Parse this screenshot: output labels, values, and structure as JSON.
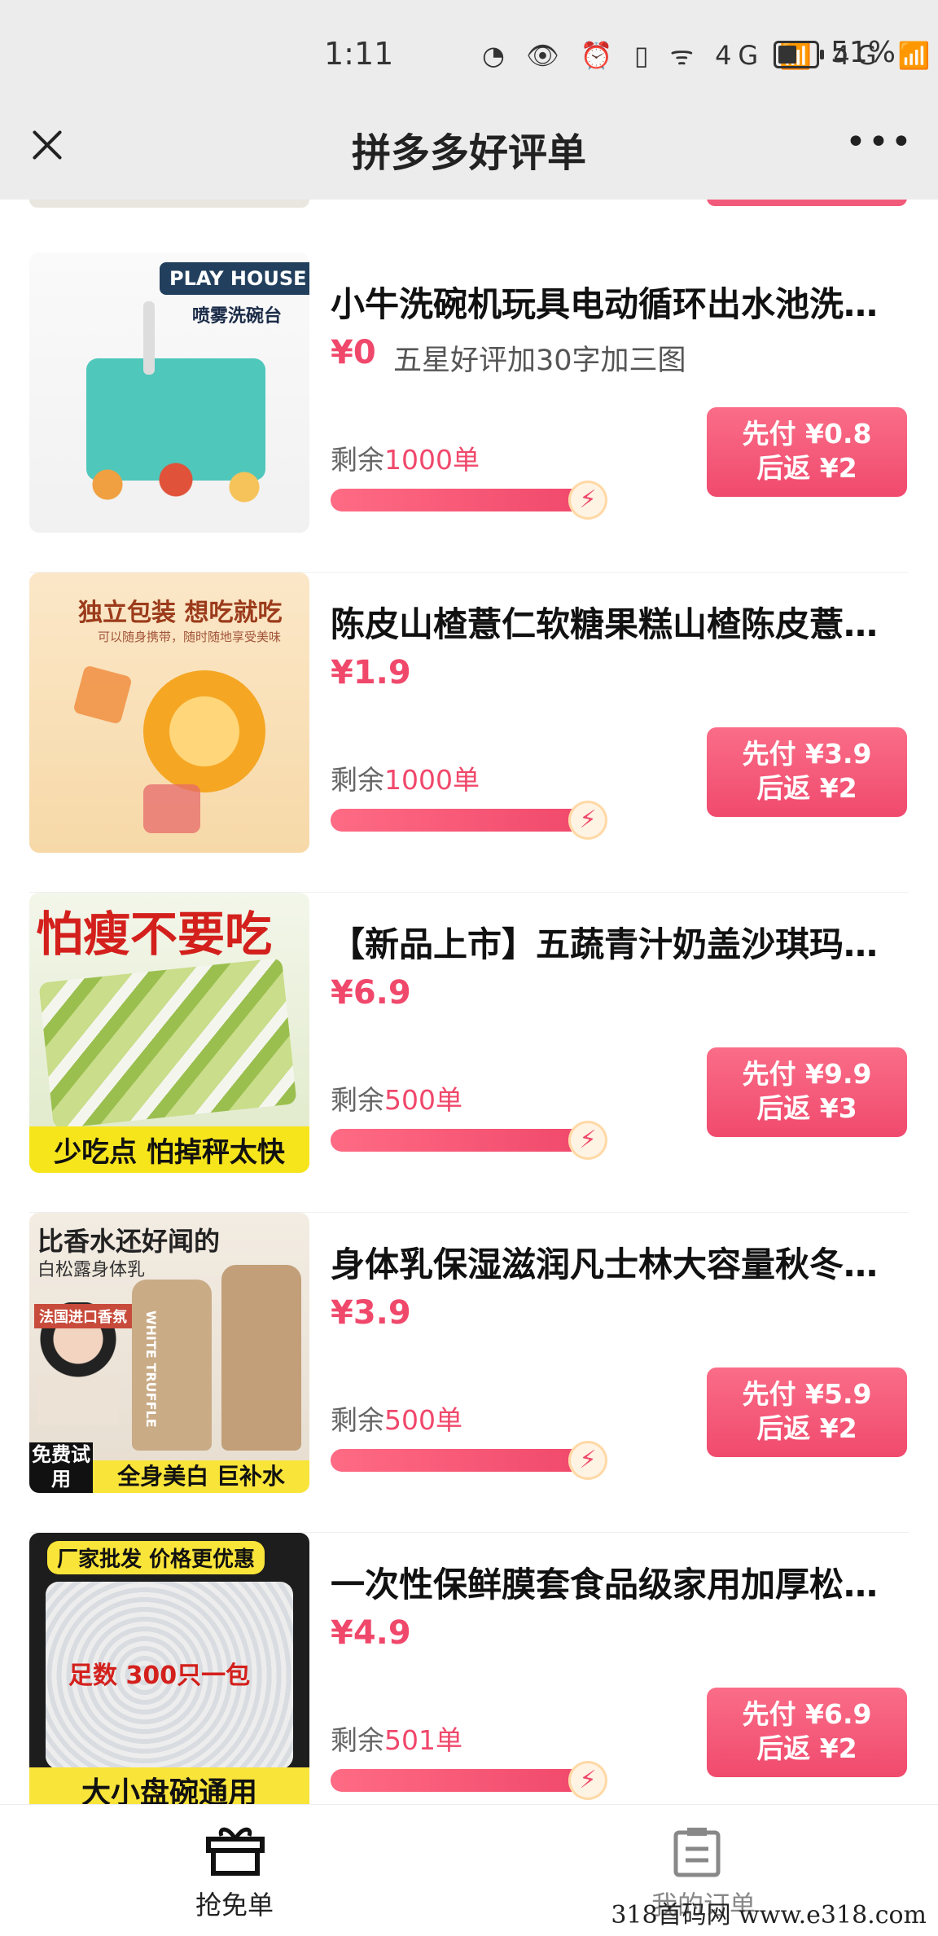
{
  "status_bar": {
    "time": "1:11",
    "network_icons": "◔ 👁 ⏰ ▯ ᯤ 4G 📶 4G 📶",
    "battery_pct": "51%",
    "battery_level": 0.51
  },
  "header": {
    "title": "拼多多好评单",
    "close_icon": "close-icon",
    "more_label": "•••"
  },
  "items": [
    {
      "name": "小牛洗碗机玩具电动循环出水池洗…",
      "price": "¥0",
      "note": "五星好评加30字加三图",
      "remain_label": "剩余",
      "remain_count": "1000单",
      "progress": 0.95,
      "btn_line1": "先付 ¥0.8",
      "btn_line2": "后返 ¥2",
      "thumb": {
        "tag1": "PLAY HOUSE",
        "tag2": "喷雾洗碗台"
      }
    },
    {
      "name": "陈皮山楂薏仁软糖果糕山楂陈皮薏…",
      "price": "¥1.9",
      "note": "",
      "remain_label": "剩余",
      "remain_count": "1000单",
      "progress": 0.95,
      "btn_line1": "先付 ¥3.9",
      "btn_line2": "后返 ¥2",
      "thumb": {
        "tag1": "独立包装 想吃就吃",
        "tag2": "可以随身携带，随时随地享受美味"
      }
    },
    {
      "name": "【新品上市】五蔬青汁奶盖沙琪玛…",
      "price": "¥6.9",
      "note": "",
      "remain_label": "剩余",
      "remain_count": "500单",
      "progress": 0.95,
      "btn_line1": "先付 ¥9.9",
      "btn_line2": "后返 ¥3",
      "thumb": {
        "tag1": "怕瘦不要吃",
        "tag2": "少吃点 怕掉秤太快"
      }
    },
    {
      "name": "身体乳保湿滋润凡士林大容量秋冬…",
      "price": "¥3.9",
      "note": "",
      "remain_label": "剩余",
      "remain_count": "500单",
      "progress": 0.95,
      "btn_line1": "先付 ¥5.9",
      "btn_line2": "后返 ¥2",
      "thumb": {
        "tag1": "比香水还好闻的",
        "tag2": "白松露身体乳",
        "tag3": "法国进口香氛",
        "tag4": "免费试用",
        "tag5": "全身美白 巨补水",
        "tag6": "WHITE TRUFFLE"
      }
    },
    {
      "name": "一次性保鲜膜套食品级家用加厚松…",
      "price": "¥4.9",
      "note": "",
      "remain_label": "剩余",
      "remain_count": "501单",
      "progress": 0.95,
      "btn_line1": "先付 ¥6.9",
      "btn_line2": "后返 ¥2",
      "thumb": {
        "tag1": "厂家批发 价格更优惠",
        "tag2": "足数 300只一包",
        "tag3": "大小盘碗通用"
      }
    }
  ],
  "bottom_nav": {
    "tab1": "抢免单",
    "tab2": "我的订单"
  },
  "watermark": "318首码网 www.e318.com",
  "colors": {
    "accent": "#f0486b",
    "button": "#f25a79"
  }
}
